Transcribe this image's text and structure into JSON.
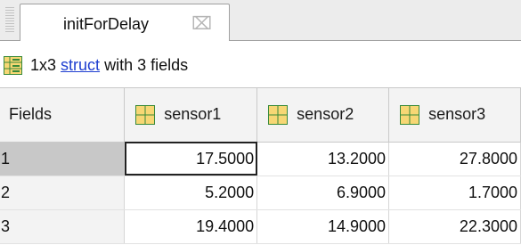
{
  "tab": {
    "title": "initForDelay",
    "close_glyph": "⌧"
  },
  "info": {
    "dims": "1x3",
    "type_link": "struct",
    "suffix": "with 3 fields"
  },
  "table": {
    "corner_header": "Fields",
    "columns": [
      "sensor1",
      "sensor2",
      "sensor3"
    ],
    "rows": [
      {
        "label": "1",
        "values": [
          "17.5000",
          "13.2000",
          "27.8000"
        ]
      },
      {
        "label": "2",
        "values": [
          "5.2000",
          "6.9000",
          "1.7000"
        ]
      },
      {
        "label": "3",
        "values": [
          "19.4000",
          "14.9000",
          "22.3000"
        ]
      }
    ]
  },
  "icons": {
    "struct": "struct-variable-icon",
    "field": "numeric-field-icon"
  },
  "colors": {
    "link": "#1f3fd0",
    "icon_fill": "#f7d774",
    "icon_border": "#3a8a3a",
    "selected_row_header": "#c8c8c8"
  }
}
